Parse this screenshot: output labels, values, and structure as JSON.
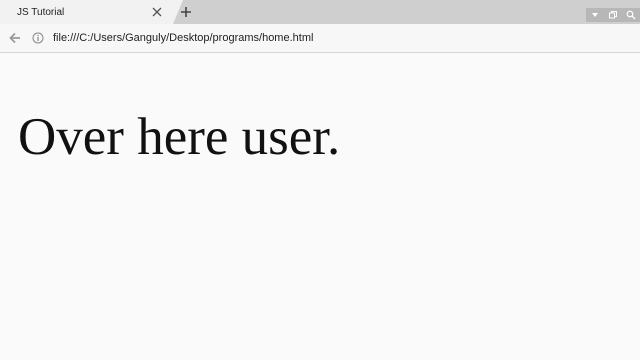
{
  "tab": {
    "title": "JS Tutorial",
    "close_icon": "close-icon"
  },
  "new_tab_icon": "plus-icon",
  "window_controls": [
    "minimize-icon",
    "restore-icon",
    "search-icon"
  ],
  "address_bar": {
    "back_icon": "back-arrow-icon",
    "info_icon": "info-icon",
    "url": "file:///C:/Users/Ganguly/Desktop/programs/home.html"
  },
  "page": {
    "heading": "Over here user."
  },
  "colors": {
    "tabstrip": "#cfcfcf",
    "active_tab": "#f2f2f2",
    "toolbar": "#f7f7f7",
    "page_background": "#fafafa",
    "text": "#111111"
  }
}
